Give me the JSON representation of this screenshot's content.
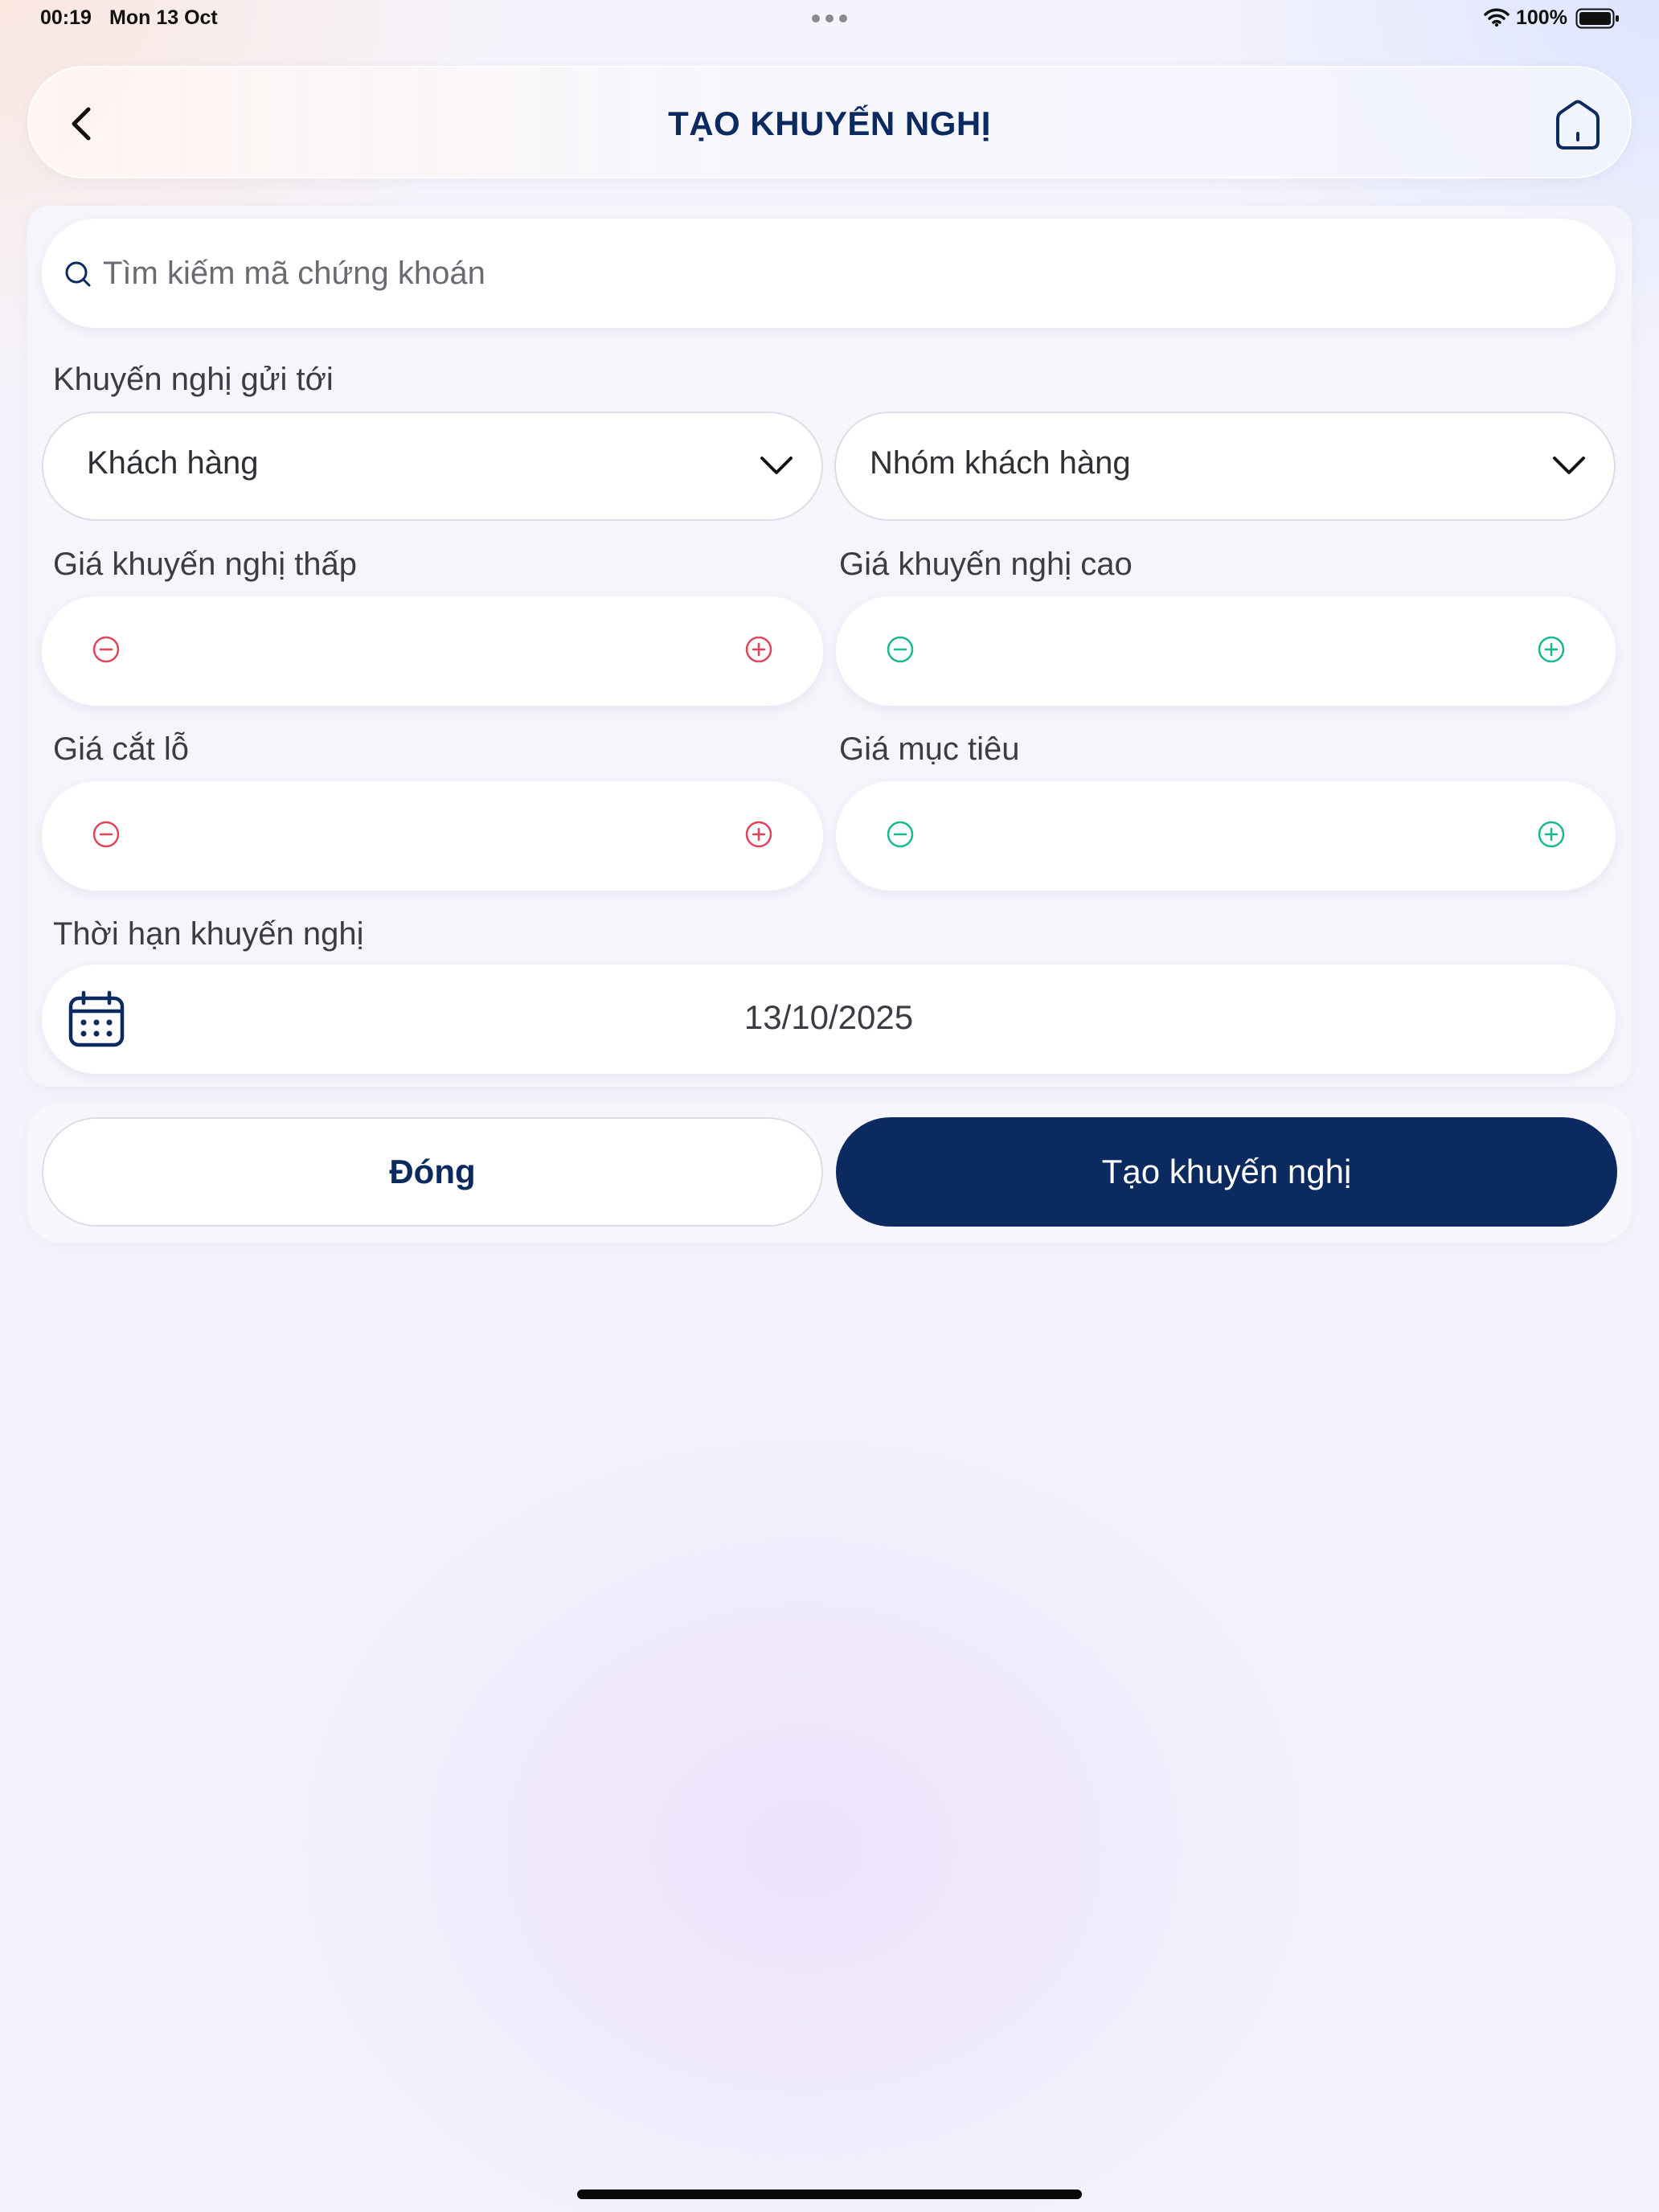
{
  "status_bar": {
    "time": "00:19",
    "date": "Mon 13 Oct",
    "battery": "100%"
  },
  "header": {
    "title": "TẠO KHUYẾN NGHỊ",
    "back_icon": "chevron-left-icon",
    "home_icon": "home-icon"
  },
  "form": {
    "search": {
      "placeholder": "Tìm kiếm mã chứng khoán",
      "value": ""
    },
    "recipients_label": "Khuyến nghị gửi tới",
    "customer_dropdown": "Khách hàng",
    "customer_group_dropdown": "Nhóm khách hàng",
    "low_price_label": "Giá khuyến nghị thấp",
    "high_price_label": "Giá khuyến nghị cao",
    "stop_loss_label": "Giá cắt lỗ",
    "target_label": "Giá mục tiêu",
    "duration_label": "Thời hạn khuyến nghị",
    "duration_value": "13/10/2025"
  },
  "actions": {
    "close_label": "Đóng",
    "create_label": "Tạo khuyến nghị"
  },
  "colors": {
    "primary": "#0b2a60",
    "stepper_red": "#e0435a",
    "stepper_green": "#17b890"
  }
}
